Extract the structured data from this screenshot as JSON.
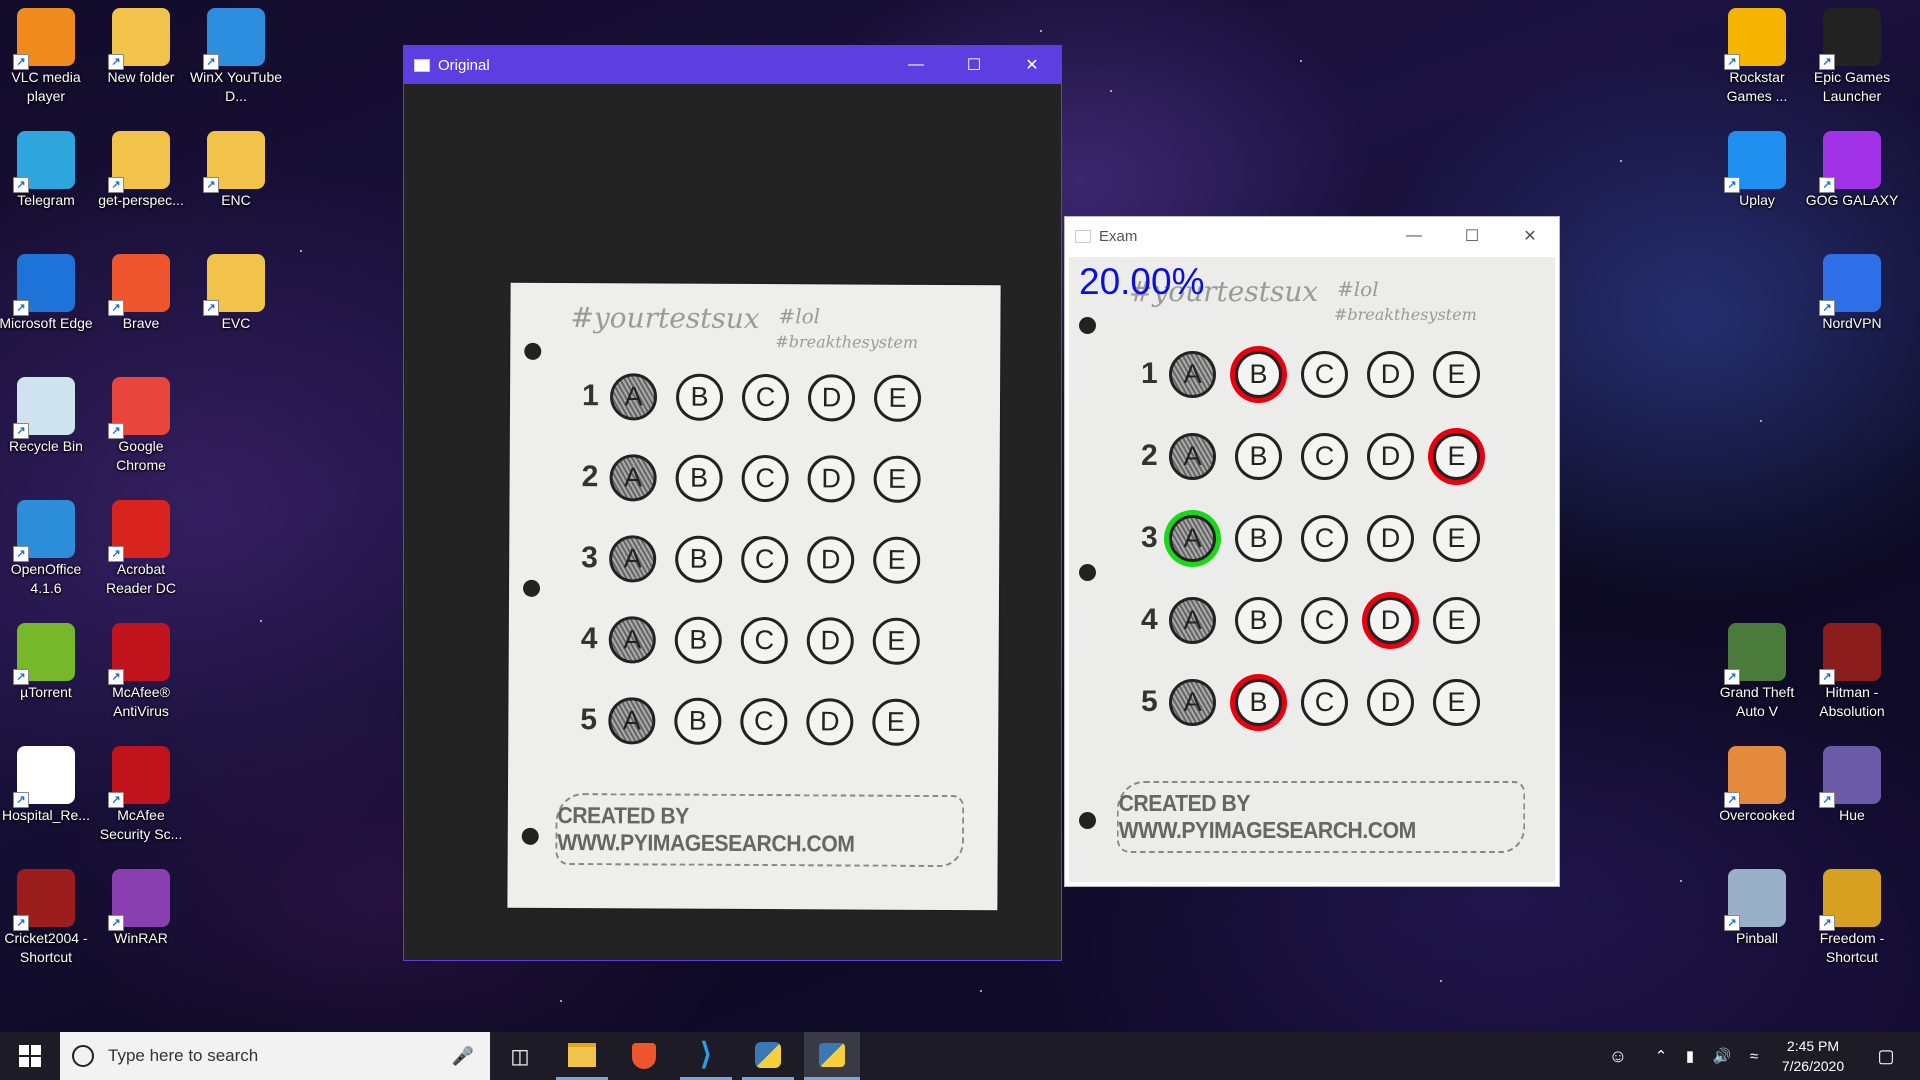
{
  "desktop": {
    "left_icons": [
      {
        "label": "VLC media player",
        "icon": "vlc-cone-icon",
        "color": "#f08a1c"
      },
      {
        "label": "New folder",
        "icon": "folder-icon",
        "color": "#f2c34a"
      },
      {
        "label": "WinX YouTube D...",
        "icon": "youtube-icon",
        "color": "#2d8ee0"
      },
      {
        "label": "Telegram",
        "icon": "telegram-icon",
        "color": "#2ea6dd"
      },
      {
        "label": "get-perspec...",
        "icon": "python-file-icon",
        "color": "#f2c34a"
      },
      {
        "label": "ENC",
        "icon": "pdf-folder-icon",
        "color": "#f2c34a"
      },
      {
        "label": "Microsoft Edge",
        "icon": "edge-icon",
        "color": "#1e73d8"
      },
      {
        "label": "Brave",
        "icon": "brave-lion-icon",
        "color": "#f0562e"
      },
      {
        "label": "EVC",
        "icon": "pdf-folder-icon",
        "color": "#f2c34a"
      },
      {
        "label": "Recycle Bin",
        "icon": "recycle-bin-icon",
        "color": "#cfe3ee"
      },
      {
        "label": "Google Chrome",
        "icon": "chrome-icon",
        "color": "#e8453c"
      },
      {
        "label": "OpenOffice 4.1.6",
        "icon": "openoffice-icon",
        "color": "#2c8ed8"
      },
      {
        "label": "Acrobat Reader DC",
        "icon": "acrobat-icon",
        "color": "#d9231e"
      },
      {
        "label": "µTorrent",
        "icon": "utorrent-icon",
        "color": "#76b82a"
      },
      {
        "label": "McAfee® AntiVirus",
        "icon": "mcafee-shield-icon",
        "color": "#c0131b"
      },
      {
        "label": "Hospital_Re...",
        "icon": "pdf-file-icon",
        "color": "#ffffff"
      },
      {
        "label": "McAfee Security Sc...",
        "icon": "mcafee-shield-icon",
        "color": "#c0131b"
      },
      {
        "label": "Cricket2004 - Shortcut",
        "icon": "cricket-ball-icon",
        "color": "#9b1d1d"
      },
      {
        "label": "WinRAR",
        "icon": "winrar-books-icon",
        "color": "#8a3fb0"
      }
    ],
    "right_icons": [
      {
        "label": "Rockstar Games ...",
        "icon": "rockstar-icon",
        "color": "#f4b400"
      },
      {
        "label": "Epic Games Launcher",
        "icon": "epic-games-icon",
        "color": "#222222"
      },
      {
        "label": "Uplay",
        "icon": "uplay-swirl-icon",
        "color": "#1f8ff0"
      },
      {
        "label": "GOG GALAXY",
        "icon": "gog-galaxy-ring-icon",
        "color": "#a232e8"
      },
      {
        "label": "NordVPN",
        "icon": "nordvpn-icon",
        "color": "#2e6ee6"
      },
      {
        "label": "Grand Theft Auto V",
        "icon": "gta-v-icon",
        "color": "#4a7b3a"
      },
      {
        "label": "Hitman - Absolution",
        "icon": "hitman-icon",
        "color": "#8c1d1d"
      },
      {
        "label": "Overcooked",
        "icon": "overcooked-chef-icon",
        "color": "#e38a3c"
      },
      {
        "label": "Hue",
        "icon": "hue-character-icon",
        "color": "#6b5aa8"
      },
      {
        "label": "Pinball",
        "icon": "pinball-icon",
        "color": "#9ab0c8"
      },
      {
        "label": "Freedom - Shortcut",
        "icon": "freedom-torch-icon",
        "color": "#d8a020"
      }
    ]
  },
  "windows": {
    "original": {
      "title": "Original",
      "accent": "#5b3fe0"
    },
    "exam": {
      "title": "Exam",
      "score": "20.00%"
    }
  },
  "sheet": {
    "handwriting_main": "#yourtestsux",
    "handwriting_lol": "#lol",
    "handwriting_sub": "#breakthesystem",
    "letters": [
      "A",
      "B",
      "C",
      "D",
      "E"
    ],
    "questions": [
      "1",
      "2",
      "3",
      "4",
      "5"
    ],
    "footer": "CREATED BY WWW.PYIMAGESEARCH.COM"
  },
  "exam_marks": [
    {
      "question": "1",
      "circled": "B",
      "status": "wrong"
    },
    {
      "question": "2",
      "circled": "E",
      "status": "wrong"
    },
    {
      "question": "3",
      "circled": "A",
      "status": "correct"
    },
    {
      "question": "4",
      "circled": "D",
      "status": "wrong"
    },
    {
      "question": "5",
      "circled": "B",
      "status": "wrong"
    }
  ],
  "taskbar": {
    "search_placeholder": "Type here to search",
    "time": "2:45 PM",
    "date": "7/26/2020",
    "apps": [
      "file-explorer-icon",
      "brave-icon",
      "vscode-icon",
      "python-idle-icon",
      "python-window-icon"
    ]
  }
}
